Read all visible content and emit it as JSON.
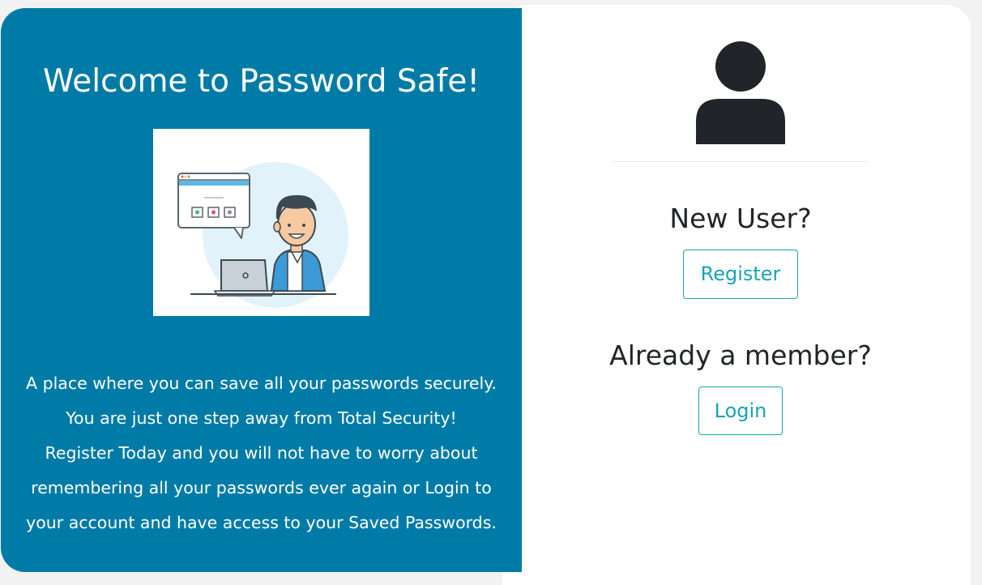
{
  "welcome": {
    "title": "Welcome to Password Safe!"
  },
  "illustration": {
    "icon": "person-at-laptop-illustration"
  },
  "description": {
    "lines": [
      "A place where you can save all your passwords securely.",
      "You are just one step away from Total Security!",
      "Register Today and you will not have to worry about",
      "remembering all your passwords ever again or Login to",
      "your account and have access to your Saved Passwords."
    ]
  },
  "auth": {
    "user_icon": "user-icon",
    "new_user_heading": "New User?",
    "register_label": "Register",
    "member_heading": "Already a member?",
    "login_label": "Login"
  },
  "colors": {
    "primary_blue": "#007ba7",
    "button_accent": "#17a2b8",
    "dark_text": "#212529"
  }
}
